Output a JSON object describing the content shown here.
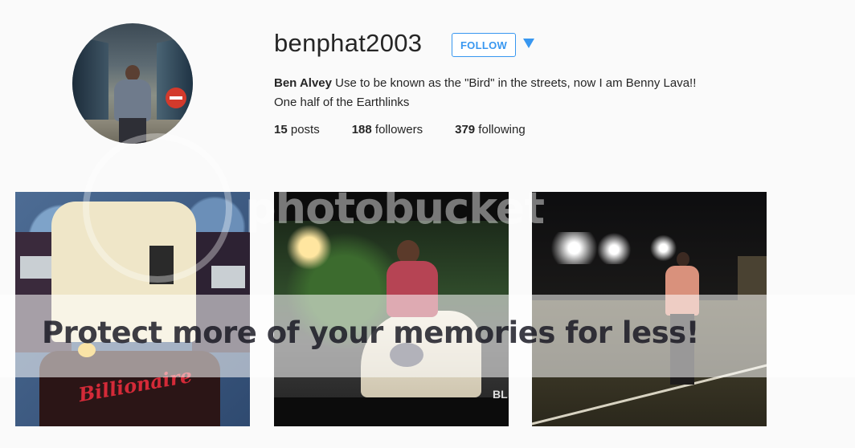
{
  "profile": {
    "username": "benphat2003",
    "follow_label": "FOLLOW",
    "full_name": "Ben Alvey",
    "bio_line1": " Use to be known as the \"Bird\" in the streets, now I am Benny Lava!!",
    "bio_line2": "One half of the Earthlinks",
    "stats": {
      "posts_count": "15",
      "posts_label": " posts",
      "followers_count": "188",
      "followers_label": " followers",
      "following_count": "379",
      "following_label": " following"
    }
  },
  "photos": {
    "photo1_shirt_text": "Billionaire",
    "photo2_plate_text": "BL"
  },
  "watermark": {
    "brand": "photobucket",
    "message": "Protect more of your memories for less!"
  },
  "colors": {
    "accent": "#3897f0",
    "text": "#262626",
    "background": "#fafafa"
  }
}
